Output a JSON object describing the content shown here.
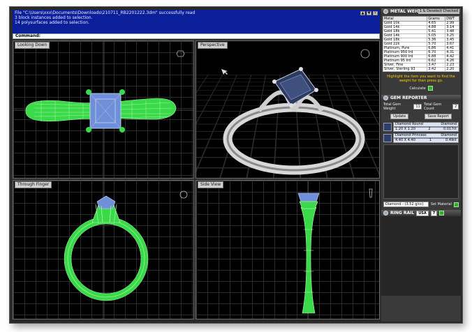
{
  "command": {
    "lines": [
      "File \"C:\\Users\\xxx\\Documents\\Downloads\\210711_RB2201222.3dm\" successfully read",
      "3 block instances added to selection.",
      "14 polysurfaces added to selection."
    ],
    "prompt": "Command:",
    "controls": [
      "▲",
      "▼",
      "×"
    ]
  },
  "viewports": {
    "top": "Looking Down",
    "perspective": "Perspective",
    "front": "Through Finger",
    "side": "Side View"
  },
  "metal_weights": {
    "title": "METAL WEIGHTS",
    "tag": "1 & Deselect Checked",
    "columns": [
      "Metal",
      "Grams",
      "DWT"
    ],
    "rows": [
      [
        "Gold 10k",
        "4.65",
        "2.99"
      ],
      [
        "Gold 14k",
        "4.88",
        "3.14"
      ],
      [
        "Gold 18k",
        "5.41",
        "3.48"
      ],
      [
        "Gold 14k",
        "5.05",
        "3.25"
      ],
      [
        "Gold 18k",
        "5.36",
        "3.45"
      ],
      [
        "Gold 22k",
        "5.70",
        "3.67"
      ],
      [
        "Platinum, Pure",
        "6.86",
        "4.41"
      ],
      [
        "Platinum 950 Ird",
        "6.70",
        "4.31"
      ],
      [
        "Platinum 900 Ird",
        "6.88",
        "4.42"
      ],
      [
        "Platinum 95 Ird",
        "6.62",
        "4.26"
      ],
      [
        "Silver, Fine",
        "3.47",
        "2.23"
      ],
      [
        "Silver, Sterling 93",
        "3.42",
        "2.20"
      ]
    ],
    "hint": "Highlight the item you want to find the weight for then press go.",
    "calc_label": "Calculate"
  },
  "gem_reporter": {
    "title": "GEM REPORTER",
    "total_weight_label": "Total Gem Weight",
    "total_weight_value": "11",
    "total_count_label": "Total Gem Count",
    "total_count_value": "2",
    "update_label": "Update",
    "save_label": "Save Report",
    "items": [
      {
        "name": "Diamond Round",
        "type": "Diamond",
        "size": "1.20 X 1.20",
        "qty": "2",
        "ct": "0.017ct"
      },
      {
        "name": "Diamond Princess",
        "type": "Diamond",
        "size": "4.40 X 4.40",
        "qty": "1",
        "ct": "0.49ct"
      }
    ],
    "material_value": "Diamond - (3.52 g/cc)",
    "set_material_label": "Set Material"
  },
  "ring_rail": {
    "title": "RING RAIL",
    "select_value": "USA",
    "size_value": "7"
  }
}
